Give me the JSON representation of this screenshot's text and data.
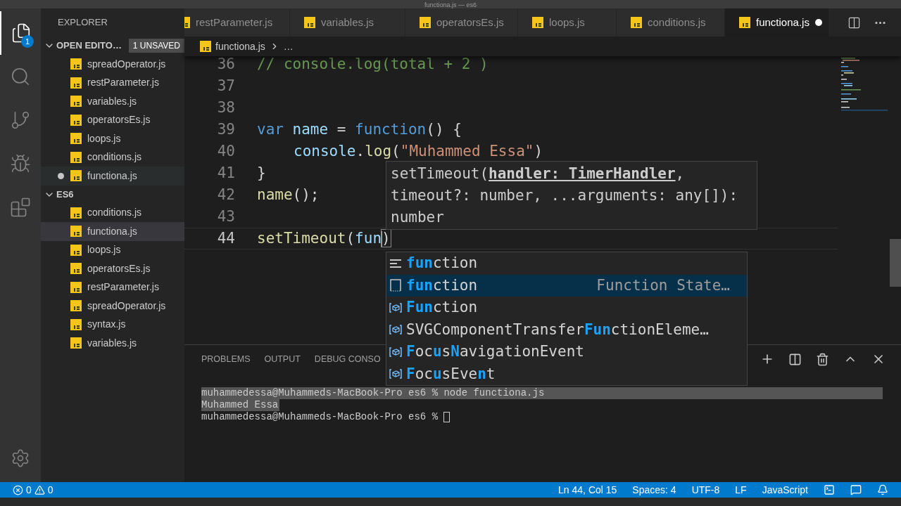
{
  "window": {
    "title": "functiona.js — es6"
  },
  "activity_bar": [
    {
      "kind": "files",
      "selected": true,
      "badge": "1"
    },
    {
      "kind": "search",
      "selected": false
    },
    {
      "kind": "source-control",
      "selected": false
    },
    {
      "kind": "run",
      "selected": false
    },
    {
      "kind": "extensions",
      "selected": false
    }
  ],
  "sidebar": {
    "title": "EXPLORER",
    "sections": [
      {
        "title": "OPEN EDITO…",
        "badge": "1 UNSAVED",
        "expanded": true,
        "items": [
          {
            "name": "spreadOperator.js",
            "unsaved": false,
            "selected": false
          },
          {
            "name": "restParameter.js",
            "unsaved": false,
            "selected": false
          },
          {
            "name": "variables.js",
            "unsaved": false,
            "selected": false
          },
          {
            "name": "operatorsEs.js",
            "unsaved": false,
            "selected": false
          },
          {
            "name": "loops.js",
            "unsaved": false,
            "selected": false
          },
          {
            "name": "conditions.js",
            "unsaved": false,
            "selected": false
          },
          {
            "name": "functiona.js",
            "unsaved": true,
            "selected": false
          }
        ]
      },
      {
        "title": "ES6",
        "expanded": true,
        "items": [
          {
            "name": "conditions.js",
            "unsaved": false,
            "selected": false
          },
          {
            "name": "functiona.js",
            "unsaved": false,
            "selected": true
          },
          {
            "name": "loops.js",
            "unsaved": false,
            "selected": false
          },
          {
            "name": "operatorsEs.js",
            "unsaved": false,
            "selected": false
          },
          {
            "name": "restParameter.js",
            "unsaved": false,
            "selected": false
          },
          {
            "name": "spreadOperator.js",
            "unsaved": false,
            "selected": false
          },
          {
            "name": "syntax.js",
            "unsaved": false,
            "selected": false
          },
          {
            "name": "variables.js",
            "unsaved": false,
            "selected": false
          }
        ]
      }
    ]
  },
  "tabs": [
    {
      "label": "restParameter.js",
      "selected": false,
      "unsaved": false
    },
    {
      "label": "variables.js",
      "selected": false,
      "unsaved": false
    },
    {
      "label": "operatorsEs.js",
      "selected": false,
      "unsaved": false
    },
    {
      "label": "loops.js",
      "selected": false,
      "unsaved": false
    },
    {
      "label": "conditions.js",
      "selected": false,
      "unsaved": false
    },
    {
      "label": "functiona.js",
      "selected": true,
      "unsaved": true
    }
  ],
  "breadcrumb": [
    "functiona.js",
    "…"
  ],
  "code": [
    {
      "number": "36",
      "current": false,
      "tokens": [
        {
          "kind": "comment",
          "text": "// console.log(total + 2 )"
        }
      ]
    },
    {
      "number": "37",
      "current": false
    },
    {
      "number": "38",
      "current": false
    },
    {
      "number": "39",
      "current": false,
      "tokens": [
        {
          "kind": "keyword",
          "text": "var "
        },
        {
          "kind": "variable",
          "text": "name"
        },
        {
          "kind": "plain",
          "text": " = "
        },
        {
          "kind": "keyword",
          "text": "function"
        },
        {
          "kind": "plain",
          "text": "() {"
        }
      ]
    },
    {
      "number": "40",
      "current": false,
      "indented": true,
      "tokens": [
        {
          "kind": "variable",
          "text": "console"
        },
        {
          "kind": "plain",
          "text": "."
        },
        {
          "kind": "function",
          "text": "log"
        },
        {
          "kind": "plain",
          "text": "("
        },
        {
          "kind": "string",
          "text": "\"Muhammed Essa\""
        },
        {
          "kind": "plain",
          "text": ")"
        }
      ]
    },
    {
      "number": "41",
      "current": false,
      "tokens": [
        {
          "kind": "plain",
          "text": "}"
        }
      ]
    },
    {
      "number": "42",
      "current": false,
      "tokens": [
        {
          "kind": "function",
          "text": "name"
        },
        {
          "kind": "plain",
          "text": "();"
        }
      ]
    },
    {
      "number": "43",
      "current": false
    },
    {
      "number": "44",
      "current": true,
      "tokens": [
        {
          "kind": "function",
          "text": "setTimeout"
        },
        {
          "kind": "plain",
          "text": "("
        },
        {
          "kind": "variable",
          "text": "fun"
        },
        {
          "kind": "bracket",
          "text": ")"
        }
      ]
    }
  ],
  "hover": {
    "signature": "setTimeout(**handler: TimerHandler**, timeout?: number, ...arguments: any[]): number"
  },
  "suggestions": [
    {
      "kind": "keyword",
      "label": "**fun**ction",
      "selected": false
    },
    {
      "kind": "snippet",
      "label": "**fun**ction",
      "detail": "Function State…",
      "selected": true
    },
    {
      "kind": "variable",
      "label": "**Fun**ction",
      "selected": false
    },
    {
      "kind": "variable",
      "label": "SVGComponentTransfer**Fun**ctionEleme…",
      "selected": false
    },
    {
      "kind": "variable",
      "label": "**F**oc**u**s**N**avigationEvent",
      "selected": false
    },
    {
      "kind": "variable",
      "label": "**F**oc**u**sEve**n**t",
      "selected": false
    }
  ],
  "panel": {
    "tabs": [
      {
        "label": "PROBLEMS",
        "selected": false
      },
      {
        "label": "OUTPUT",
        "selected": false
      },
      {
        "label": "DEBUG CONSO",
        "selected": false
      }
    ],
    "terminal": [
      {
        "text": "muhammedessa@Muhammeds-MacBook-Pro es6 % node functiona.js",
        "selected": true
      },
      {
        "text": "Muhammed Essa",
        "selected": true
      },
      {
        "text": "muhammedessa@Muhammeds-MacBook-Pro es6 % ",
        "selected": false,
        "cursor": true
      }
    ]
  },
  "status_bar": {
    "errors": "0",
    "warnings": "0",
    "right": [
      "Ln 44, Col 15",
      "Spaces: 4",
      "UTF-8",
      "LF",
      "JavaScript"
    ]
  }
}
